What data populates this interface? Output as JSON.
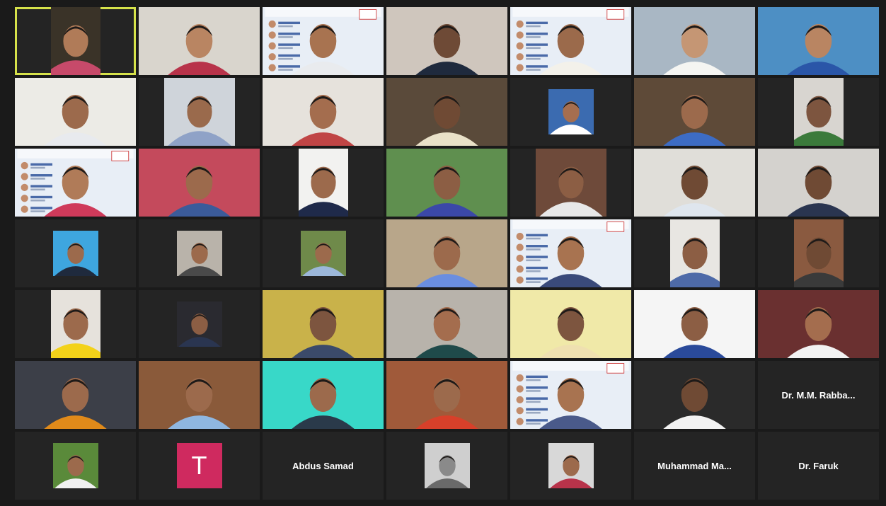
{
  "meeting": {
    "tiles": [
      {
        "id": "r1c1",
        "kind": "video",
        "fit": "narrow",
        "bg": "#3a3328",
        "skin": "#b07b58",
        "shirt": "#c74a6a",
        "active": true
      },
      {
        "id": "r1c2",
        "kind": "video",
        "fit": "full",
        "bg": "#d9d5cd",
        "skin": "#b98562",
        "shirt": "#b8334a"
      },
      {
        "id": "r1c3",
        "kind": "poster",
        "fit": "full",
        "bg": "#e8eef6",
        "skin": "#a87350",
        "shirt": "#e9ebee"
      },
      {
        "id": "r1c4",
        "kind": "video",
        "fit": "full",
        "bg": "#cfc6bd",
        "skin": "#6e4a36",
        "shirt": "#1f2a3d"
      },
      {
        "id": "r1c5",
        "kind": "poster",
        "fit": "full",
        "bg": "#e8eef6",
        "skin": "#9b6a4b",
        "shirt": "#f3f1ea"
      },
      {
        "id": "r1c6",
        "kind": "video",
        "fit": "full",
        "bg": "#a9b7c4",
        "skin": "#c59674",
        "shirt": "#f5f5f2"
      },
      {
        "id": "r1c7",
        "kind": "video",
        "fit": "full",
        "bg": "#4d8fc4",
        "skin": "#b98562",
        "shirt": "#2a56a8"
      },
      {
        "id": "r2c1",
        "kind": "video",
        "fit": "full",
        "bg": "#ecebe6",
        "skin": "#9c6a4c",
        "shirt": "#e8eaee"
      },
      {
        "id": "r2c2",
        "kind": "video",
        "fit": "narrow2",
        "bg": "#cfd4da",
        "skin": "#9a6a4c",
        "shirt": "#8fa2c7"
      },
      {
        "id": "r2c3",
        "kind": "video",
        "fit": "full",
        "bg": "#e6e2dc",
        "skin": "#a46d4e",
        "shirt": "#c04545"
      },
      {
        "id": "r2c4",
        "kind": "video",
        "fit": "full",
        "bg": "#5a4a3a",
        "skin": "#6f4a34",
        "shirt": "#e9e1c8"
      },
      {
        "id": "r2c5",
        "kind": "thumb",
        "bg": "#3b6bb0",
        "skin": "#a56e4f",
        "shirt": "#ffffff"
      },
      {
        "id": "r2c6",
        "kind": "video",
        "fit": "full",
        "bg": "#5e4a38",
        "skin": "#9c6a4c",
        "shirt": "#3d6cc4"
      },
      {
        "id": "r2c7",
        "kind": "video",
        "fit": "narrow",
        "bg": "#d8d5d0",
        "skin": "#7d553f",
        "shirt": "#3b7a3b"
      },
      {
        "id": "r3c1",
        "kind": "poster",
        "fit": "full",
        "bg": "#e8eef6",
        "skin": "#b07b58",
        "shirt": "#cf3a5a"
      },
      {
        "id": "r3c2",
        "kind": "video",
        "fit": "full",
        "bg": "#c44a5c",
        "skin": "#9c6a4c",
        "shirt": "#3b5b9a"
      },
      {
        "id": "r3c3",
        "kind": "video",
        "fit": "narrow",
        "bg": "#f2f2f0",
        "skin": "#9c6a4c",
        "shirt": "#1f2a4a"
      },
      {
        "id": "r3c4",
        "kind": "video",
        "fit": "full",
        "bg": "#5f8f4f",
        "skin": "#8c5e44",
        "shirt": "#3b48a8"
      },
      {
        "id": "r3c5",
        "kind": "video",
        "fit": "narrow2",
        "bg": "#6e4a3a",
        "skin": "#8c5e44",
        "shirt": "#e8e8e8"
      },
      {
        "id": "r3c6",
        "kind": "video",
        "fit": "full",
        "bg": "#e0ded9",
        "skin": "#6f4a34",
        "shirt": "#dfe6ee"
      },
      {
        "id": "r3c7",
        "kind": "video",
        "fit": "full",
        "bg": "#d4d2ce",
        "skin": "#6f4a34",
        "shirt": "#2a3550"
      },
      {
        "id": "r4c1",
        "kind": "thumb",
        "bg": "#3ea6df",
        "skin": "#9c6a4c",
        "shirt": "#1f2a3d"
      },
      {
        "id": "r4c2",
        "kind": "thumb",
        "bg": "#b9b3aa",
        "skin": "#9c6a4c",
        "shirt": "#4a4a4a"
      },
      {
        "id": "r4c3",
        "kind": "thumb",
        "bg": "#6f8a4a",
        "skin": "#9c6a4c",
        "shirt": "#9cb7d9"
      },
      {
        "id": "r4c4",
        "kind": "video",
        "fit": "full",
        "bg": "#b8a68a",
        "skin": "#9c6a4c",
        "shirt": "#6a8ee0"
      },
      {
        "id": "r4c5",
        "kind": "poster",
        "fit": "full",
        "bg": "#e8eef6",
        "skin": "#a87350",
        "shirt": "#3a4a7a"
      },
      {
        "id": "r4c6",
        "kind": "video",
        "fit": "narrow",
        "bg": "#e8e6e2",
        "skin": "#8c5e44",
        "shirt": "#4e6aa8"
      },
      {
        "id": "r4c7",
        "kind": "video",
        "fit": "narrow",
        "bg": "#8a5a40",
        "skin": "#6f4a34",
        "shirt": "#3a3a3a"
      },
      {
        "id": "r5c1",
        "kind": "video",
        "fit": "narrow",
        "bg": "#e6e2dc",
        "skin": "#9c6a4c",
        "shirt": "#f3d21a"
      },
      {
        "id": "r5c2",
        "kind": "thumb",
        "bg": "#2a2a30",
        "skin": "#8c5e44",
        "shirt": "#2a3550"
      },
      {
        "id": "r5c3",
        "kind": "video",
        "fit": "full",
        "bg": "#c9b24a",
        "skin": "#7d553f",
        "shirt": "#3b4a6a"
      },
      {
        "id": "r5c4",
        "kind": "video",
        "fit": "full",
        "bg": "#b8b3ab",
        "skin": "#a46d4e",
        "shirt": "#1f4a4a"
      },
      {
        "id": "r5c5",
        "kind": "video",
        "fit": "full",
        "bg": "#f0e9a8",
        "skin": "#7d553f",
        "shirt": "#efe0b0"
      },
      {
        "id": "r5c6",
        "kind": "video",
        "fit": "full",
        "bg": "#f5f5f5",
        "skin": "#8c5e44",
        "shirt": "#2a4a9a"
      },
      {
        "id": "r5c7",
        "kind": "video",
        "fit": "full",
        "bg": "#6a3030",
        "skin": "#a46d4e",
        "shirt": "#f2f2f2"
      },
      {
        "id": "r6c1",
        "kind": "video",
        "fit": "full",
        "bg": "#3c3f48",
        "skin": "#9c6a4c",
        "shirt": "#e08a1a"
      },
      {
        "id": "r6c2",
        "kind": "video",
        "fit": "full",
        "bg": "#8a5a3a",
        "skin": "#9c6a4c",
        "shirt": "#8fb7e0"
      },
      {
        "id": "r6c3",
        "kind": "video",
        "fit": "full",
        "bg": "#38d8c8",
        "skin": "#9c6a4c",
        "shirt": "#2a3a4a"
      },
      {
        "id": "r6c4",
        "kind": "video",
        "fit": "full",
        "bg": "#a05a3a",
        "skin": "#9c6a4c",
        "shirt": "#d8402a"
      },
      {
        "id": "r6c5",
        "kind": "poster",
        "fit": "full",
        "bg": "#e8eef6",
        "skin": "#a87350",
        "shirt": "#4a5a8a"
      },
      {
        "id": "r6c6",
        "kind": "video",
        "fit": "full",
        "bg": "#2a2a2a",
        "skin": "#6f4a34",
        "shirt": "#f2f2f2"
      },
      {
        "id": "r6c7",
        "kind": "name",
        "name": "Dr. M.M. Rabba..."
      },
      {
        "id": "r7c1",
        "kind": "thumb",
        "bg": "#5a8a3a",
        "skin": "#9c6a4c",
        "shirt": "#f0f0f0"
      },
      {
        "id": "r7c2",
        "kind": "initial",
        "initial": "T"
      },
      {
        "id": "r7c3",
        "kind": "name",
        "name": "Abdus Samad"
      },
      {
        "id": "r7c4",
        "kind": "thumb",
        "bg": "#cfcfcf",
        "skin": "#8a8a8a",
        "shirt": "#6a6a6a"
      },
      {
        "id": "r7c5",
        "kind": "thumb",
        "bg": "#d8d8d8",
        "skin": "#9c6a4c",
        "shirt": "#b8334a"
      },
      {
        "id": "r7c6",
        "kind": "name",
        "name": "Muhammad  Ma..."
      },
      {
        "id": "r7c7",
        "kind": "name",
        "name": "Dr. Faruk"
      }
    ]
  }
}
